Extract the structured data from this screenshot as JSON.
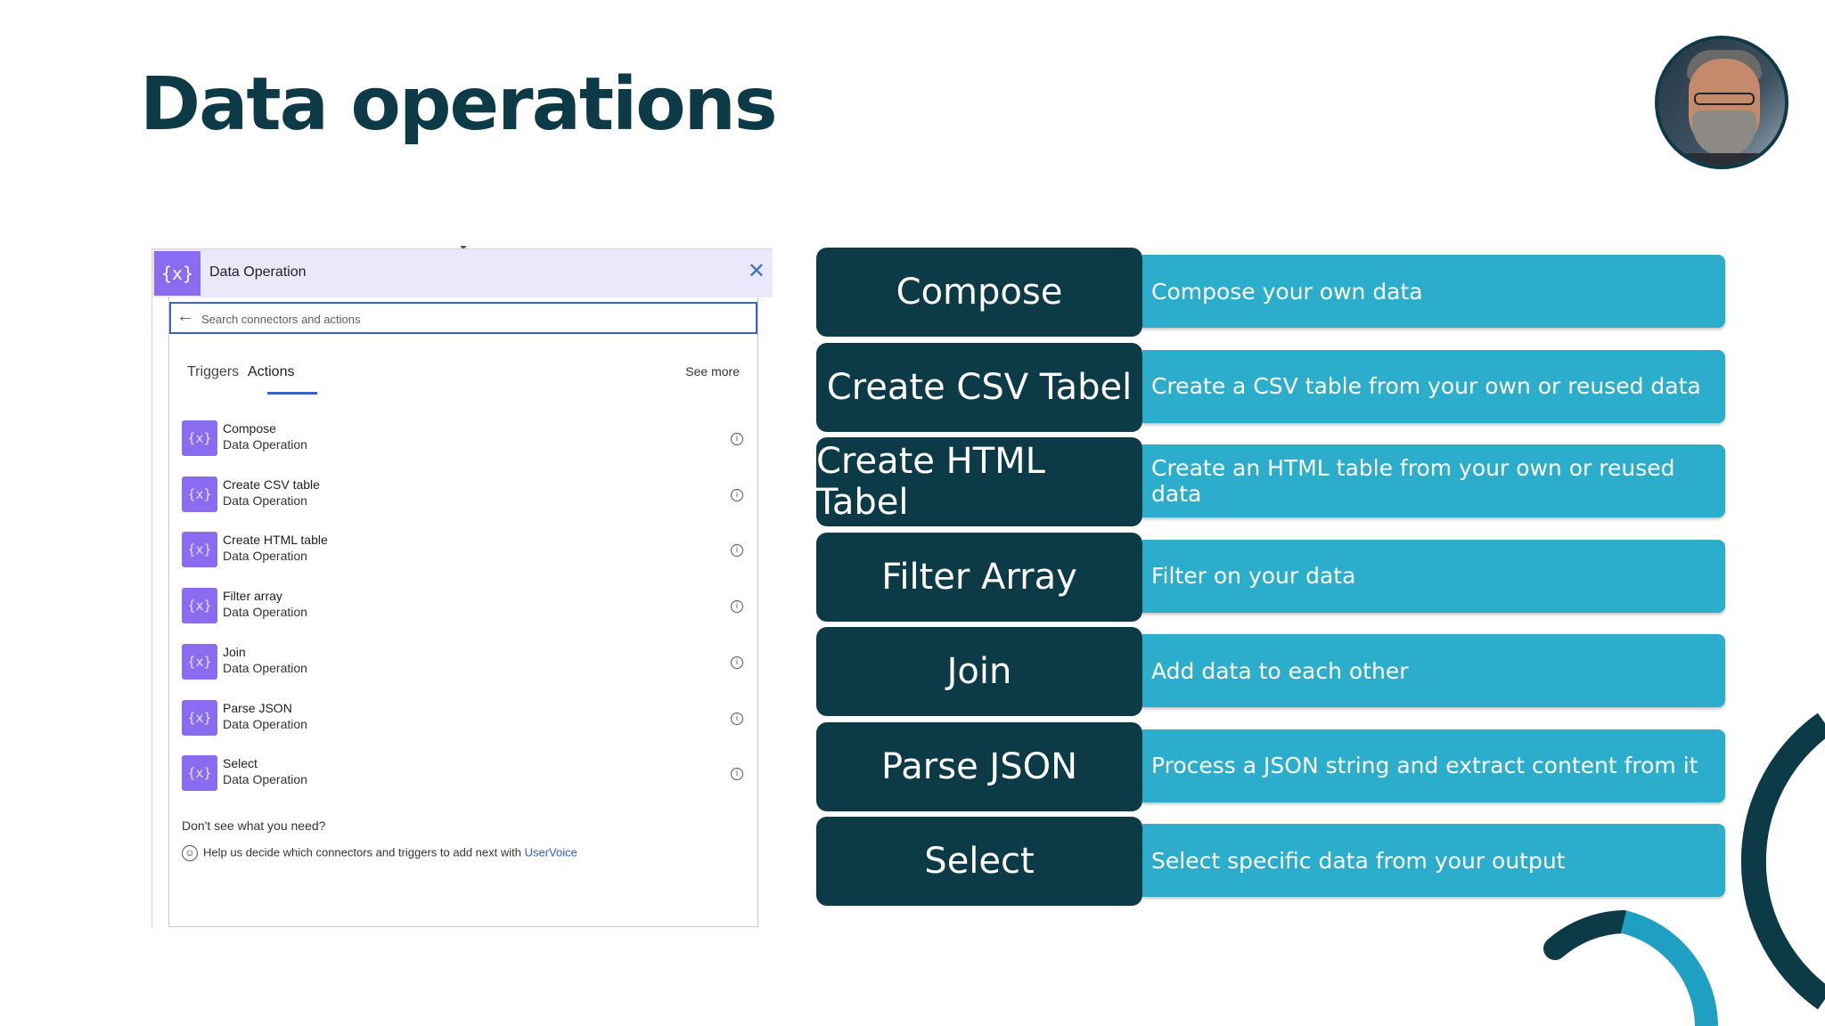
{
  "page_title": "Data operations",
  "panel": {
    "header_icon": "{x}",
    "title": "Data Operation",
    "close_icon": "✕",
    "search_placeholder": "Search connectors and actions",
    "tabs": {
      "triggers": "Triggers",
      "actions": "Actions"
    },
    "see_more": "See more",
    "actions": [
      {
        "name": "Compose",
        "sub": "Data Operation"
      },
      {
        "name": "Create CSV table",
        "sub": "Data Operation"
      },
      {
        "name": "Create HTML table",
        "sub": "Data Operation"
      },
      {
        "name": "Filter array",
        "sub": "Data Operation"
      },
      {
        "name": "Join",
        "sub": "Data Operation"
      },
      {
        "name": "Parse JSON",
        "sub": "Data Operation"
      },
      {
        "name": "Select",
        "sub": "Data Operation"
      }
    ],
    "footer_question": "Don't see what you need?",
    "footer_help": "Help us decide which connectors and triggers to add next with",
    "footer_link": "UserVoice"
  },
  "operations": [
    {
      "name": "Compose",
      "description": "Compose your own data"
    },
    {
      "name": "Create CSV Tabel",
      "description": "Create a CSV table from your own or reused data"
    },
    {
      "name": "Create HTML Tabel",
      "description": "Create an HTML table from your own or reused data"
    },
    {
      "name": "Filter Array",
      "description": "Filter on your data"
    },
    {
      "name": "Join",
      "description": "Add data to each other"
    },
    {
      "name": "Parse JSON",
      "description": "Process a JSON string and extract content from it"
    },
    {
      "name": "Select",
      "description": "Select specific data from your output"
    }
  ],
  "colors": {
    "title": "#0d3a47",
    "op_name_bg": "#0d3a47",
    "op_desc_bg": "#2badcb",
    "panel_accent": "#8a6cf0",
    "link": "#2c5bd6"
  }
}
